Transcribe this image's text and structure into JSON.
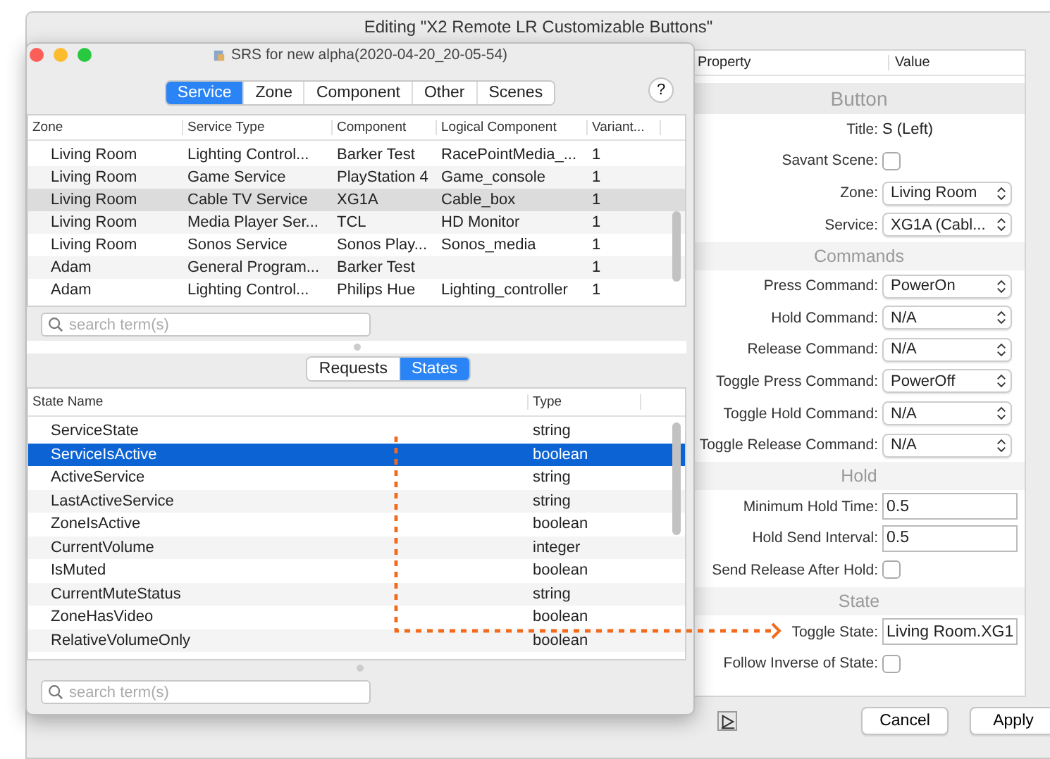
{
  "window": {
    "title": "Editing \"X2 Remote LR Customizable Buttons\""
  },
  "properties": {
    "columns": [
      "Property",
      "Value"
    ],
    "sections": [
      {
        "title": "Button",
        "rows": [
          {
            "kind": "text",
            "label": "Title:",
            "value": "S (Left)"
          },
          {
            "kind": "checkbox",
            "label": "Savant Scene:",
            "checked": false
          },
          {
            "kind": "select",
            "label": "Zone:",
            "value": "Living Room"
          },
          {
            "kind": "select",
            "label": "Service:",
            "value": "XG1A (Cabl..."
          }
        ]
      },
      {
        "title": "Commands",
        "rows": [
          {
            "kind": "select",
            "label": "Press Command:",
            "value": "PowerOn"
          },
          {
            "kind": "select",
            "label": "Hold Command:",
            "value": "N/A"
          },
          {
            "kind": "select",
            "label": "Release Command:",
            "value": "N/A"
          },
          {
            "kind": "select",
            "label": "Toggle Press Command:",
            "value": "PowerOff"
          },
          {
            "kind": "select",
            "label": "Toggle Hold Command:",
            "value": "N/A"
          },
          {
            "kind": "select",
            "label": "Toggle Release Command:",
            "value": "N/A"
          }
        ]
      },
      {
        "title": "Hold",
        "rows": [
          {
            "kind": "input",
            "label": "Minimum Hold Time:",
            "value": "0.5"
          },
          {
            "kind": "input",
            "label": "Hold Send Interval:",
            "value": "0.5"
          },
          {
            "kind": "checkbox",
            "label": "Send Release After Hold:",
            "checked": false
          }
        ]
      },
      {
        "title": "State",
        "rows": [
          {
            "kind": "input",
            "label": "Toggle State:",
            "value": "Living Room.XG1"
          },
          {
            "kind": "checkbox",
            "label": "Follow Inverse of State:",
            "checked": false
          }
        ]
      }
    ]
  },
  "buttons": [
    "Cancel",
    "Apply"
  ],
  "srs_window": {
    "title": "SRS for new alpha(2020-04-20_20-05-54)",
    "tabs": [
      {
        "label": "Service",
        "selected": true
      },
      {
        "label": "Zone",
        "selected": false
      },
      {
        "label": "Component",
        "selected": false
      },
      {
        "label": "Other",
        "selected": false
      },
      {
        "label": "Scenes",
        "selected": false
      }
    ],
    "help_button": "?",
    "services_table": {
      "columns": [
        "Zone",
        "Service Type",
        "Component",
        "Logical Component",
        "Variant..."
      ],
      "rows": [
        {
          "cells": [
            "Living Room",
            "Lighting Control...",
            "Barker Test",
            "RacePointMedia_...",
            "1"
          ],
          "selected": false
        },
        {
          "cells": [
            "Living Room",
            "Game Service",
            "PlayStation 4",
            "Game_console",
            "1"
          ],
          "selected": false
        },
        {
          "cells": [
            "Living Room",
            "Cable TV Service",
            "XG1A",
            "Cable_box",
            "1"
          ],
          "selected": true
        },
        {
          "cells": [
            "Living Room",
            "Media Player Ser...",
            "TCL",
            "HD Monitor",
            "1"
          ],
          "selected": false
        },
        {
          "cells": [
            "Living Room",
            "Sonos Service",
            "Sonos Play...",
            "Sonos_media",
            "1"
          ],
          "selected": false
        },
        {
          "cells": [
            "Adam",
            "General Program...",
            "Barker Test",
            "",
            "1"
          ],
          "selected": false
        },
        {
          "cells": [
            "Adam",
            "Lighting Control...",
            "Philips Hue",
            "Lighting_controller",
            "1"
          ],
          "selected": false
        }
      ]
    },
    "search_top": {
      "placeholder": "search term(s)"
    },
    "subtabs": [
      {
        "label": "Requests",
        "selected": false
      },
      {
        "label": "States",
        "selected": true
      }
    ],
    "states_table": {
      "columns": [
        "State Name",
        "Type"
      ],
      "rows": [
        {
          "cells": [
            "ServiceState",
            "string"
          ],
          "selected": false
        },
        {
          "cells": [
            "ServiceIsActive",
            "boolean"
          ],
          "selected": true
        },
        {
          "cells": [
            "ActiveService",
            "string"
          ],
          "selected": false
        },
        {
          "cells": [
            "LastActiveService",
            "string"
          ],
          "selected": false
        },
        {
          "cells": [
            "ZoneIsActive",
            "boolean"
          ],
          "selected": false
        },
        {
          "cells": [
            "CurrentVolume",
            "integer"
          ],
          "selected": false
        },
        {
          "cells": [
            "IsMuted",
            "boolean"
          ],
          "selected": false
        },
        {
          "cells": [
            "CurrentMuteStatus",
            "string"
          ],
          "selected": false
        },
        {
          "cells": [
            "ZoneHasVideo",
            "boolean"
          ],
          "selected": false
        },
        {
          "cells": [
            "RelativeVolumeOnly",
            "boolean"
          ],
          "selected": false
        }
      ]
    },
    "search_bottom": {
      "placeholder": "search term(s)"
    }
  }
}
